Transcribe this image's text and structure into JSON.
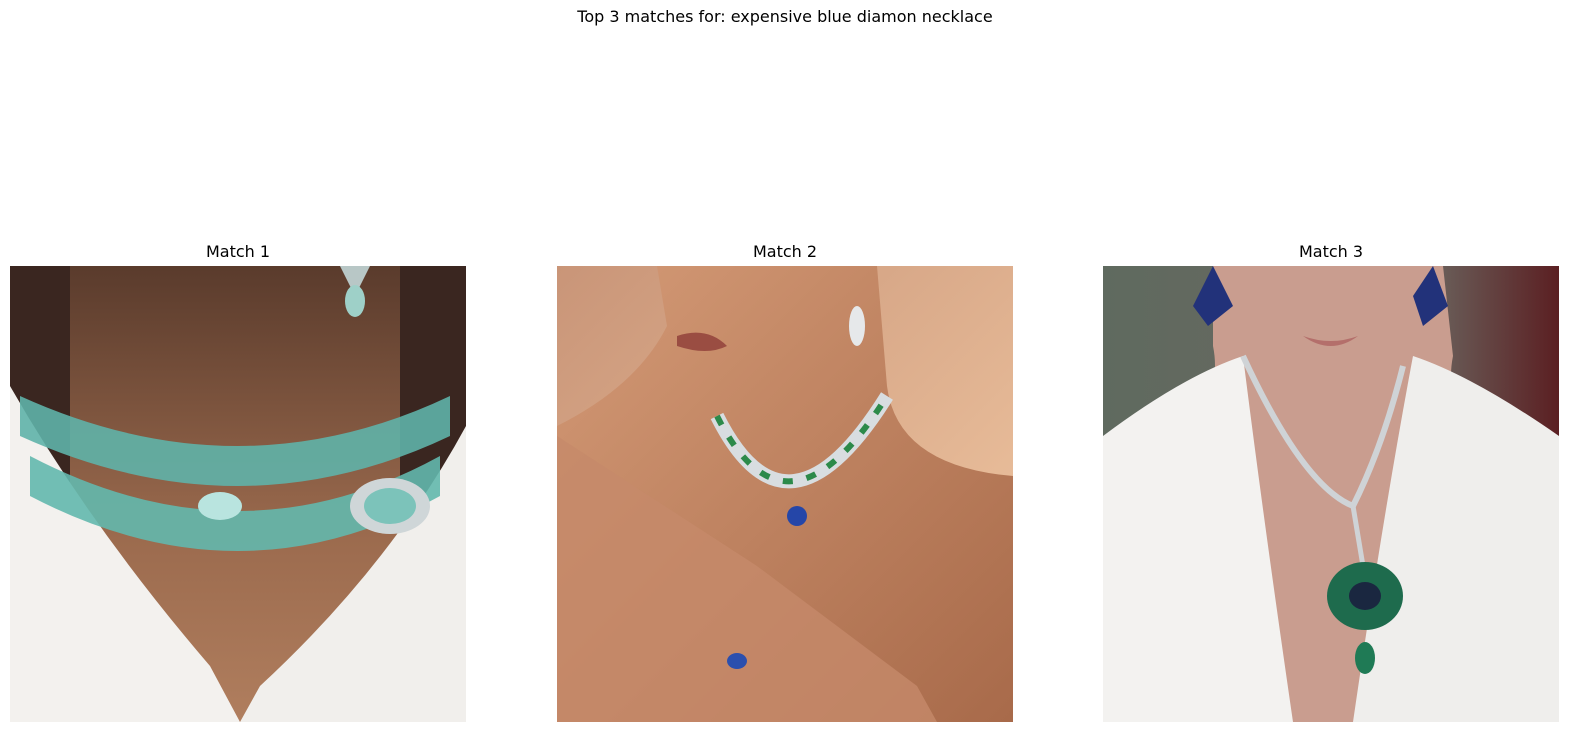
{
  "figure": {
    "suptitle": "Top 3 matches for: expensive blue diamon necklace"
  },
  "matches": [
    {
      "title": "Match 1"
    },
    {
      "title": "Match 2"
    },
    {
      "title": "Match 3"
    }
  ]
}
